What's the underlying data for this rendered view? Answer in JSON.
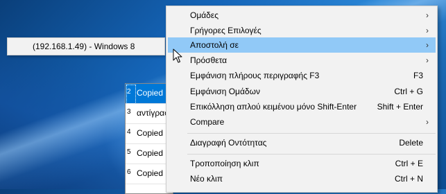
{
  "submenu": {
    "item": "(192.168.1.49) - Windows 8"
  },
  "clip_list": {
    "rows": [
      {
        "num": "2",
        "text": "Copied F",
        "selected": true
      },
      {
        "num": "3",
        "text": "αντίγραφ",
        "selected": false
      },
      {
        "num": "4",
        "text": "Copied F",
        "selected": false
      },
      {
        "num": "5",
        "text": "Copied F",
        "selected": false
      },
      {
        "num": "6",
        "text": "Copied F",
        "selected": false
      }
    ]
  },
  "context_menu": {
    "groups": "Ομάδες",
    "quick_options": "Γρήγορες Επιλογές",
    "send_to": "Αποστολή σε",
    "extras": "Πρόσθετα",
    "show_full_description": "Εμφάνιση πλήρους περιγραφής F3",
    "show_full_description_shortcut": "F3",
    "show_groups": "Εμφάνιση Ομάδων",
    "show_groups_shortcut": "Ctrl + G",
    "paste_plain_text": "Επικόλληση απλού κειμένου μόνο Shift-Enter",
    "paste_plain_text_shortcut": "Shift + Enter",
    "compare": "Compare",
    "delete_entry": "Διαγραφή Οντότητας",
    "delete_entry_shortcut": "Delete",
    "edit_clip": "Τροποποίηση κλιπ",
    "edit_clip_shortcut": "Ctrl + E",
    "new_clip": "Νέο κλιπ",
    "new_clip_shortcut": "Ctrl + N"
  },
  "colors": {
    "highlight": "#91c9f7",
    "selected_row": "#0078d7",
    "menu_bg": "#f2f2f2"
  }
}
